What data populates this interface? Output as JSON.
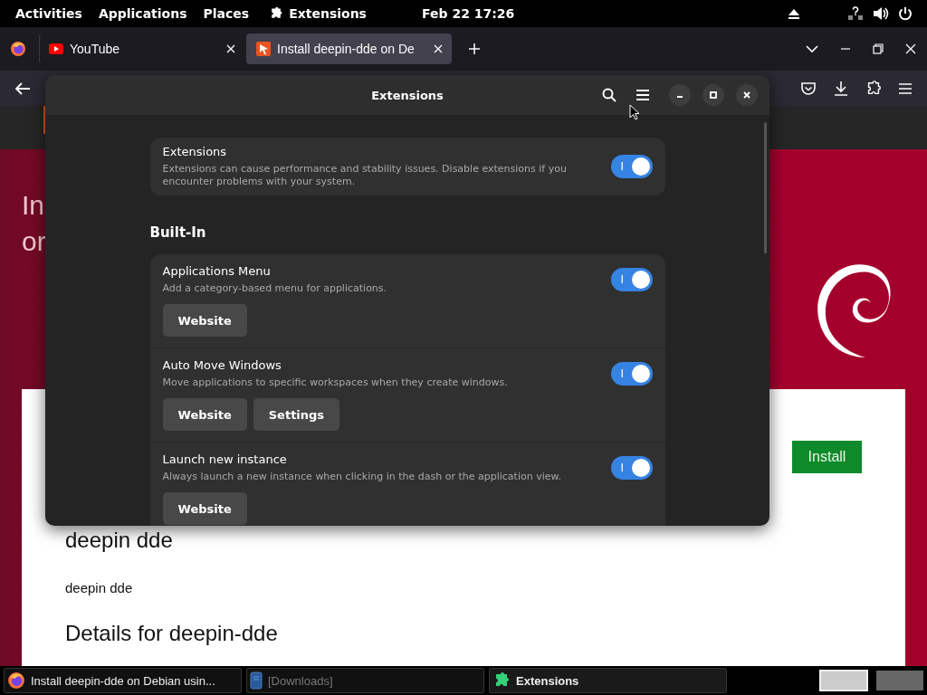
{
  "top_bar": {
    "menus": [
      {
        "label": "Activities",
        "kind": "text"
      },
      {
        "label": "Applications",
        "kind": "text"
      },
      {
        "label": "Places",
        "kind": "text"
      },
      {
        "label": "Extensions",
        "kind": "extension"
      }
    ],
    "clock": "Feb 22  17:26"
  },
  "browser": {
    "tabs": [
      {
        "title": "YouTube",
        "kind": "youtube",
        "selected": false
      },
      {
        "title": "Install deepin-dde on De",
        "kind": "snap",
        "selected": true
      }
    ],
    "page": {
      "hero_lines": [
        "In",
        "or"
      ],
      "install_button": "Install",
      "heading": "deepin dde",
      "summary": "deepin dde",
      "details_heading": "Details for deepin-dde"
    }
  },
  "extensions_window": {
    "title": "Extensions",
    "master": {
      "title": "Extensions",
      "description": "Extensions can cause performance and stability issues. Disable extensions if you encounter problems with your system.",
      "enabled": true,
      "switch_text": "I"
    },
    "section_title": "Built-In",
    "items": [
      {
        "name": "Applications Menu",
        "description": "Add a category-based menu for applications.",
        "enabled": true,
        "switch_text": "I",
        "buttons": [
          "Website"
        ]
      },
      {
        "name": "Auto Move Windows",
        "description": "Move applications to specific workspaces when they create windows.",
        "enabled": true,
        "switch_text": "I",
        "buttons": [
          "Website",
          "Settings"
        ]
      },
      {
        "name": "Launch new instance",
        "description": "Always launch a new instance when clicking in the dash or the application view.",
        "enabled": true,
        "switch_text": "I",
        "buttons": [
          "Website"
        ]
      }
    ]
  },
  "taskbar": {
    "tasks": [
      {
        "label": "Install deepin-dde on Debian usin...",
        "kind": "browser",
        "minimized": false,
        "selected": false
      },
      {
        "label": "[Downloads]",
        "kind": "files",
        "minimized": true,
        "selected": false
      },
      {
        "label": "Extensions",
        "kind": "extensions",
        "minimized": false,
        "selected": true
      }
    ],
    "workspaces": [
      {
        "selected": true
      },
      {
        "selected": false
      }
    ]
  }
}
